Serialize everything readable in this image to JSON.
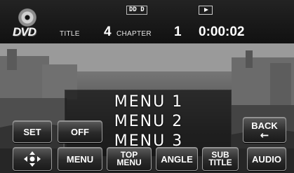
{
  "header": {
    "logo_text": "DVD",
    "format_badge": "DD D",
    "title_label": "TITLE",
    "title_number": "4",
    "chapter_label": "CHAPTER",
    "chapter_number": "1",
    "time": "0:00:02",
    "play_icon": "play-icon"
  },
  "menu": {
    "items": [
      {
        "label": "MENU 1"
      },
      {
        "label": "MENU 2"
      },
      {
        "label": "MENU 3"
      }
    ]
  },
  "buttons": {
    "set": "SET",
    "off": "OFF",
    "back": "BACK",
    "back_arrow": "←",
    "direction": "dpad-icon",
    "menu": "MENU",
    "top_menu_line1": "TOP",
    "top_menu_line2": "MENU",
    "angle": "ANGLE",
    "subtitle_line1": "SUB",
    "subtitle_line2": "TITLE",
    "audio": "AUDIO"
  }
}
